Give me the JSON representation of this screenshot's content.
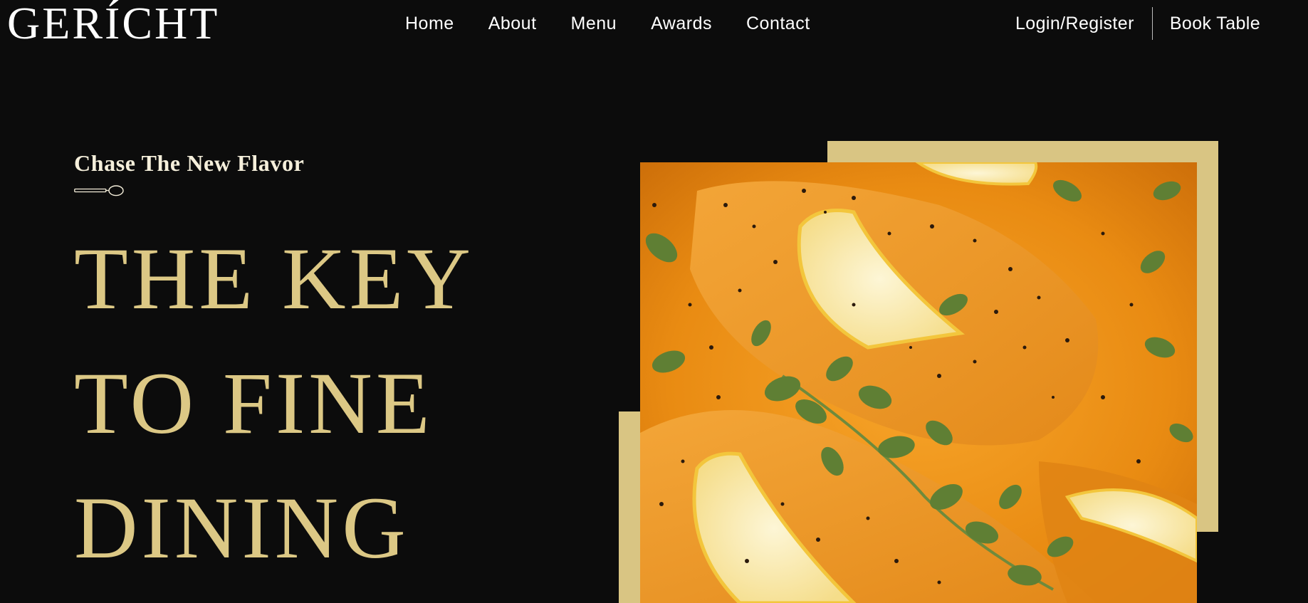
{
  "brand": {
    "logo": "GERÍCHT"
  },
  "nav": {
    "links": [
      "Home",
      "About",
      "Menu",
      "Awards",
      "Contact"
    ],
    "login": "Login/Register",
    "book": "Book Table"
  },
  "hero": {
    "subtitle": "Chase The New Flavor",
    "headline": [
      "THE KEY",
      "TO FINE",
      "DINING"
    ]
  },
  "image": {
    "icon": "spoon-icon"
  },
  "colors": {
    "background": "#0c0c0c",
    "gold": "#dcc885",
    "text": "#ffffff"
  }
}
